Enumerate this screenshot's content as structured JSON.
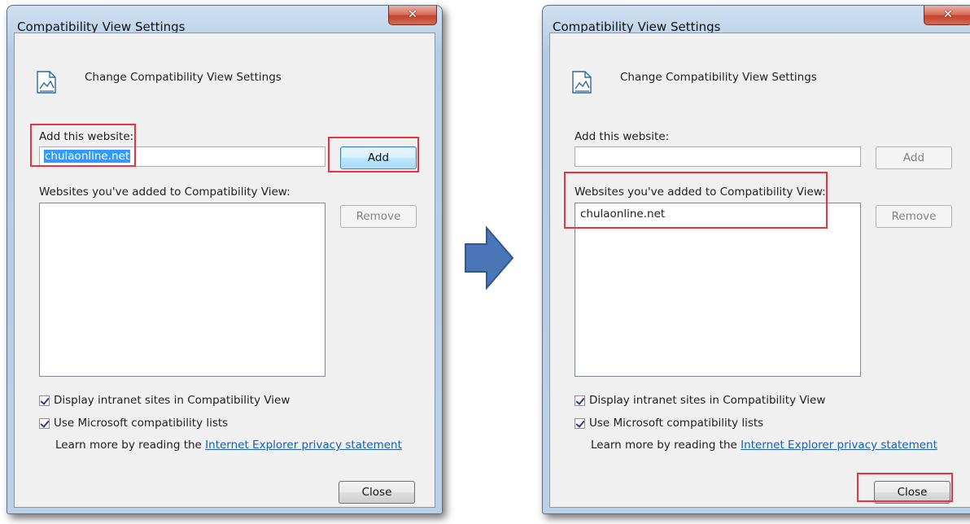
{
  "dialogs": [
    {
      "title": "Compatibility View Settings",
      "close_glyph": "✕",
      "header": "Change Compatibility View Settings",
      "add_label": "Add this website:",
      "add_value": "chulaonline.net",
      "add_button": "Add",
      "list_label": "Websites you've added to Compatibility View:",
      "list_items": [],
      "remove_button": "Remove",
      "check_intranet": "Display intranet sites in Compatibility View",
      "check_ms_lists": "Use Microsoft compatibility lists",
      "learn_prefix": "Learn more by reading the",
      "learn_link": "Internet Explorer privacy statement",
      "close_button": "Close"
    },
    {
      "title": "Compatibility View Settings",
      "close_glyph": "✕",
      "header": "Change Compatibility View Settings",
      "add_label": "Add this website:",
      "add_value": "",
      "add_button": "Add",
      "list_label": "Websites you've added to Compatibility View:",
      "list_items": [
        "chulaonline.net"
      ],
      "remove_button": "Remove",
      "check_intranet": "Display intranet sites in Compatibility View",
      "check_ms_lists": "Use Microsoft compatibility lists",
      "learn_prefix": "Learn more by reading the",
      "learn_link": "Internet Explorer privacy statement",
      "close_button": "Close"
    }
  ],
  "colors": {
    "highlight": "#e8343c",
    "arrow": "#4a76b8",
    "link": "#1a5fb4",
    "selection": "#3399ff"
  },
  "icons": {
    "header": "document-image-icon",
    "arrow": "right-arrow-icon"
  }
}
